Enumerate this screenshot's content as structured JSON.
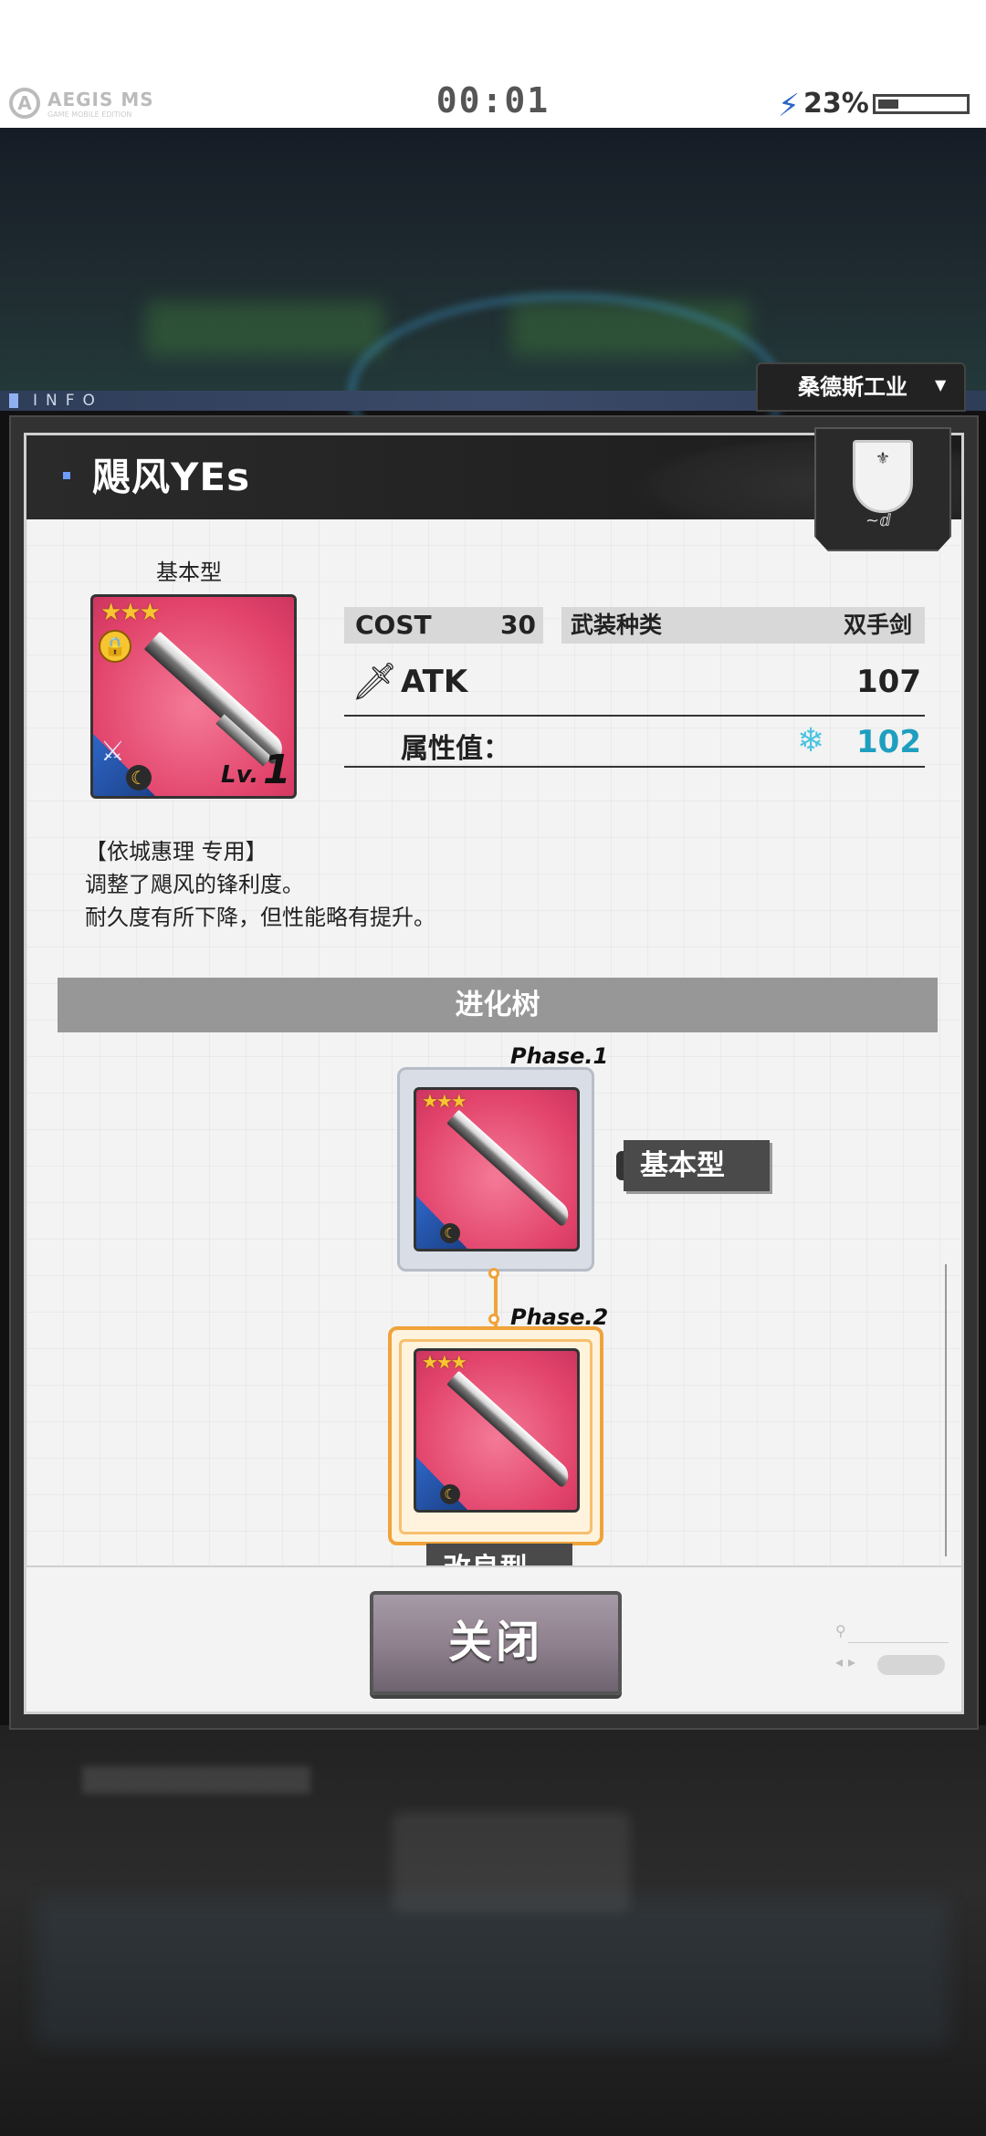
{
  "status_bar": {
    "brand": "AEGIS MS",
    "brand_sub": "GAME MOBILE EDITION",
    "timer": "00:01",
    "battery_percent": "23%",
    "battery_level": 0.23
  },
  "header": {
    "info_label": "INFO",
    "company": "桑德斯工业"
  },
  "item": {
    "name": "飓风YEs",
    "type_label": "基本型",
    "stars": "★★★",
    "level_prefix": "Lv.",
    "level": "1",
    "cost_label": "COST",
    "cost_value": "30",
    "weapon_type_label": "武装种类",
    "weapon_type_value": "双手剑",
    "atk_label": "ATK",
    "atk_value": "107",
    "attr_label": "属性值：",
    "attr_value": "102",
    "description": [
      "【依城惠理 专用】",
      "调整了飓风的锋利度。",
      "耐久度有所下降，但性能略有提升。"
    ]
  },
  "evolution": {
    "title": "进化树",
    "phases": [
      {
        "label": "Phase.1",
        "tag": "基本型"
      },
      {
        "label": "Phase.2",
        "tag": "改良型"
      }
    ]
  },
  "footer": {
    "close_label": "关闭"
  },
  "colors": {
    "accent_blue": "#6f9bff",
    "star_gold": "#f7c531",
    "attr_cyan": "#1f9fbf",
    "evo_orange": "#f0a33a"
  }
}
